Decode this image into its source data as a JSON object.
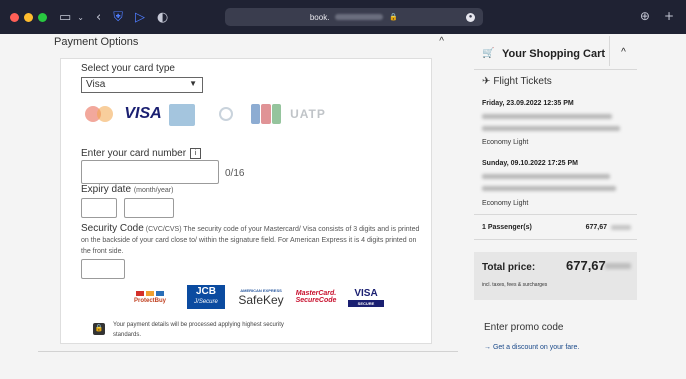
{
  "browser": {
    "url_text": "book.",
    "lock_glyph": "🔒",
    "traffic_lights": [
      "#ff5f57",
      "#febc2e",
      "#28c840"
    ]
  },
  "payment": {
    "section_title": "Payment Options",
    "collapse_glyph": "^",
    "select_card_label": "Select your card type",
    "selected_card": "Visa",
    "card_brands": {
      "visa": "VISA",
      "uatp": "UATP"
    },
    "card_number_label": "Enter your card number",
    "info_glyph": "i",
    "card_number_counter": "0/16",
    "expiry_label": "Expiry date",
    "expiry_hint": "(month/year)",
    "security_title": "Security Code",
    "security_text": "(CVC/CVS) The security code of your Mastercard/ Visa consists of 3 digits and is printed on the backside of your card close to/ within the signature field. For American Express it is 4 digits printed on the front side.",
    "badges": {
      "protectbuy": "ProtectBuy",
      "jcb_main": "JCB",
      "jcb_sub": "J/Secure",
      "safekey_top": "AMERICAN EXPRESS",
      "safekey_main": "SafeKey",
      "mc_main": "MasterCard.",
      "mc_sub": "SecureCode",
      "visa_main": "VISA",
      "visa_sub": "SECURE"
    },
    "security_notice": "Your payment details will be processed applying highest security standards."
  },
  "cart": {
    "title": "Your Shopping Cart",
    "collapse_glyph": "^",
    "flight_tickets_label": "Flight Tickets",
    "outbound_date": "Friday, 23.09.2022 12:35 PM",
    "outbound_class": "Economy Light",
    "return_date": "Sunday, 09.10.2022 17:25 PM",
    "return_class": "Economy Light",
    "passenger_label": "1 Passenger(s)",
    "passenger_price": "677,67",
    "total_label": "Total price:",
    "total_price": "677,67",
    "total_note": "incl. taxes, fees & surcharges",
    "promo_title": "Enter promo code",
    "promo_link": "→ Get a discount on your fare."
  }
}
